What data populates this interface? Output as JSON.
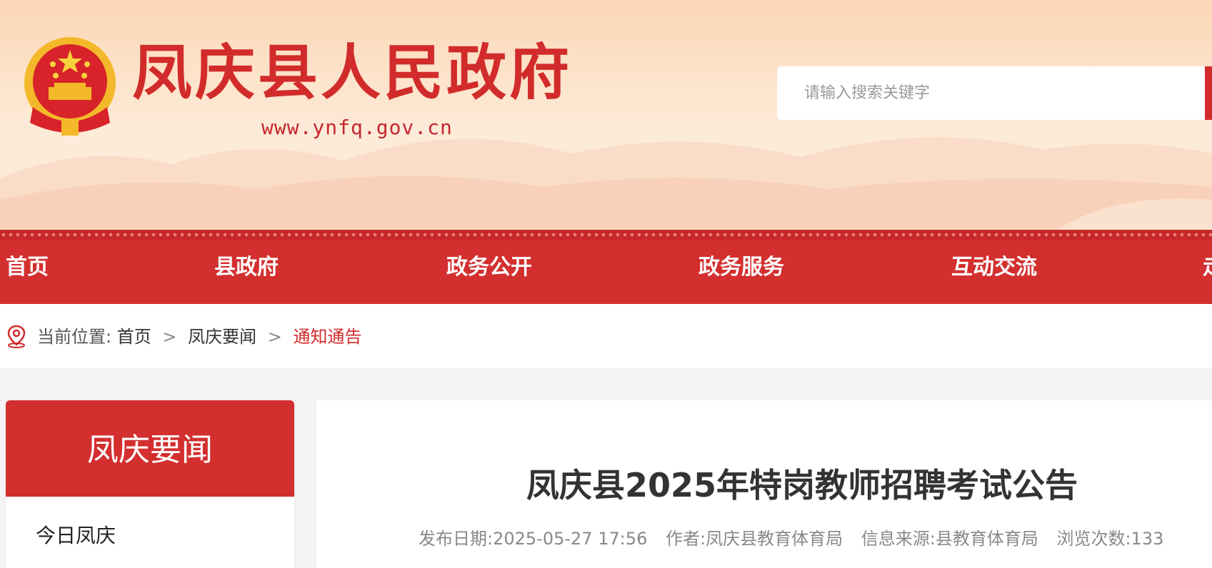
{
  "header": {
    "title": "凤庆县人民政府",
    "url": "www.ynfq.gov.cn",
    "emblem_icon": "national-emblem-icon"
  },
  "search": {
    "placeholder": "请输入搜索关键字"
  },
  "nav": {
    "items": [
      "首页",
      "县政府",
      "政务公开",
      "政务服务",
      "互动交流",
      "走"
    ]
  },
  "breadcrumb": {
    "prefix": "当前位置:",
    "home": "首页",
    "section": "凤庆要闻",
    "current": "通知通告",
    "separator": ">",
    "icon": "location-pin-icon"
  },
  "sidebar": {
    "title": "凤庆要闻",
    "items": [
      "今日凤庆"
    ]
  },
  "article": {
    "title": "凤庆县2025年特岗教师招聘考试公告",
    "meta": {
      "date": "发布日期:2025-05-27 17:56",
      "author": "作者:凤庆县教育体育局",
      "source": "信息来源:县教育体育局",
      "views": "浏览次数:133"
    }
  },
  "colors": {
    "brand_red": "#d32f2f",
    "title_red": "#d22b2b",
    "text_dark": "#333333",
    "text_meta": "#888888"
  }
}
